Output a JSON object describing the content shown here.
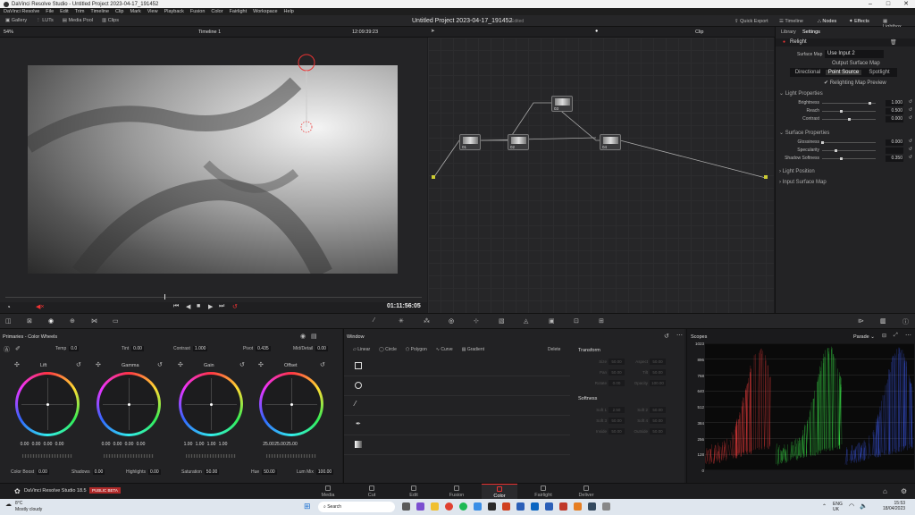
{
  "window": {
    "title": "DaVinci Resolve Studio - Untitled Project 2023-04-17_191452"
  },
  "menu": [
    "DaVinci Resolve",
    "File",
    "Edit",
    "Trim",
    "Timeline",
    "Clip",
    "Mark",
    "View",
    "Playback",
    "Fusion",
    "Color",
    "Fairlight",
    "Workspace",
    "Help"
  ],
  "toolbar": {
    "left": [
      "Gallery",
      "LUTs",
      "Media Pool",
      "Clips"
    ],
    "project_title": "Untitled Project 2023-04-17_191452",
    "project_status": "Edited",
    "right": [
      "Quick Export",
      "Timeline",
      "Nodes",
      "Effects",
      "Lightbox"
    ]
  },
  "subbar": {
    "zoom": "54%",
    "timeline_name": "Timeline 1",
    "timecode": "12:09:39:23",
    "clip_mode": "Clip"
  },
  "viewer": {
    "playhead_timecode": "01:11:56:05"
  },
  "inspector": {
    "tabs": [
      "Library",
      "Settings"
    ],
    "effect_name": "Relight",
    "surface_map_label": "Surface Map",
    "surface_map_value": "Use Input 2",
    "output_surface_map": "Output Surface Map",
    "light_types": [
      "Directional",
      "Point Source",
      "Spotlight"
    ],
    "relighting_preview": "Relighting Map Preview",
    "sections": [
      "Light Properties",
      "Surface Properties",
      "Light Position",
      "Input Surface Map"
    ],
    "light_props": [
      {
        "label": "Brightness",
        "value": "1.000",
        "fill": 0.88
      },
      {
        "label": "Reach",
        "value": "0.500",
        "fill": 0.35
      },
      {
        "label": "Contrast",
        "value": "0.000",
        "fill": 0.5
      }
    ],
    "surface_props": [
      {
        "label": "Glossiness",
        "value": "0.000",
        "fill": 0.0
      },
      {
        "label": "Specularity",
        "value": "",
        "fill": 0.25
      },
      {
        "label": "Shadow Softness",
        "value": "0.350",
        "fill": 0.35
      }
    ]
  },
  "nodes": [
    {
      "label": "01"
    },
    {
      "label": "02"
    },
    {
      "label": "03"
    },
    {
      "label": "04"
    }
  ],
  "color_wheels": {
    "header": "Primaries - Color Wheels",
    "top_params": [
      {
        "label": "Temp",
        "value": "0.0"
      },
      {
        "label": "Tint",
        "value": "0.00"
      },
      {
        "label": "Contrast",
        "value": "1.000"
      },
      {
        "label": "Pivot",
        "value": "0.435"
      },
      {
        "label": "Mid/Detail",
        "value": "0.00"
      }
    ],
    "wheels": [
      {
        "name": "Lift",
        "values": [
          "0.00",
          "0.00",
          "0.00",
          "0.00"
        ]
      },
      {
        "name": "Gamma",
        "values": [
          "0.00",
          "0.00",
          "0.00",
          "0.00"
        ]
      },
      {
        "name": "Gain",
        "values": [
          "1.00",
          "1.00",
          "1.00",
          "1.00"
        ]
      },
      {
        "name": "Offset",
        "values": [
          "25.00",
          "25.00",
          "25.00"
        ]
      }
    ],
    "bottom_params": [
      {
        "label": "Color Boost",
        "value": "0.00"
      },
      {
        "label": "Shadows",
        "value": "0.00"
      },
      {
        "label": "Highlights",
        "value": "0.00"
      },
      {
        "label": "Saturation",
        "value": "50.00"
      },
      {
        "label": "Hue",
        "value": "50.00"
      },
      {
        "label": "Lum Mix",
        "value": "100.00"
      }
    ]
  },
  "window_panel": {
    "title": "Window",
    "shapes": [
      "Linear",
      "Circle",
      "Polygon",
      "Curve",
      "Gradient"
    ],
    "delete": "Delete",
    "transform_title": "Transform",
    "transform_fields": [
      {
        "label": "Size",
        "value": "50.00"
      },
      {
        "label": "Aspect",
        "value": "50.00"
      },
      {
        "label": "Pan",
        "value": "50.00"
      },
      {
        "label": "Tilt",
        "value": "50.00"
      },
      {
        "label": "Rotate",
        "value": "0.00"
      },
      {
        "label": "Opacity",
        "value": "100.00"
      }
    ],
    "softness_title": "Softness",
    "softness_fields": [
      {
        "label": "Soft 1",
        "value": "2.50"
      },
      {
        "label": "Soft 2",
        "value": "50.00"
      },
      {
        "label": "Soft 3",
        "value": "50.00"
      },
      {
        "label": "Soft 4",
        "value": "50.00"
      },
      {
        "label": "Inside",
        "value": "50.00"
      },
      {
        "label": "Outside",
        "value": "50.00"
      }
    ]
  },
  "scopes": {
    "title": "Scopes",
    "mode": "Parade",
    "y_ticks": [
      "1023",
      "896",
      "768",
      "640",
      "512",
      "384",
      "256",
      "128",
      "0"
    ],
    "colors": {
      "red": "#ff4040",
      "green": "#40ff50",
      "blue": "#4060ff"
    }
  },
  "page_tabs": [
    "Media",
    "Cut",
    "Edit",
    "Fusion",
    "Color",
    "Fairlight",
    "Deliver"
  ],
  "active_page": "Color",
  "brand": {
    "name": "DaVinci Resolve Studio 18.5",
    "badge": "PUBLIC BETA"
  },
  "taskbar": {
    "weather_temp": "8°C",
    "weather_text": "Mostly cloudy",
    "search": "Search",
    "lang": "ENG",
    "region": "UK",
    "time": "15:53",
    "date": "18/04/2023"
  }
}
